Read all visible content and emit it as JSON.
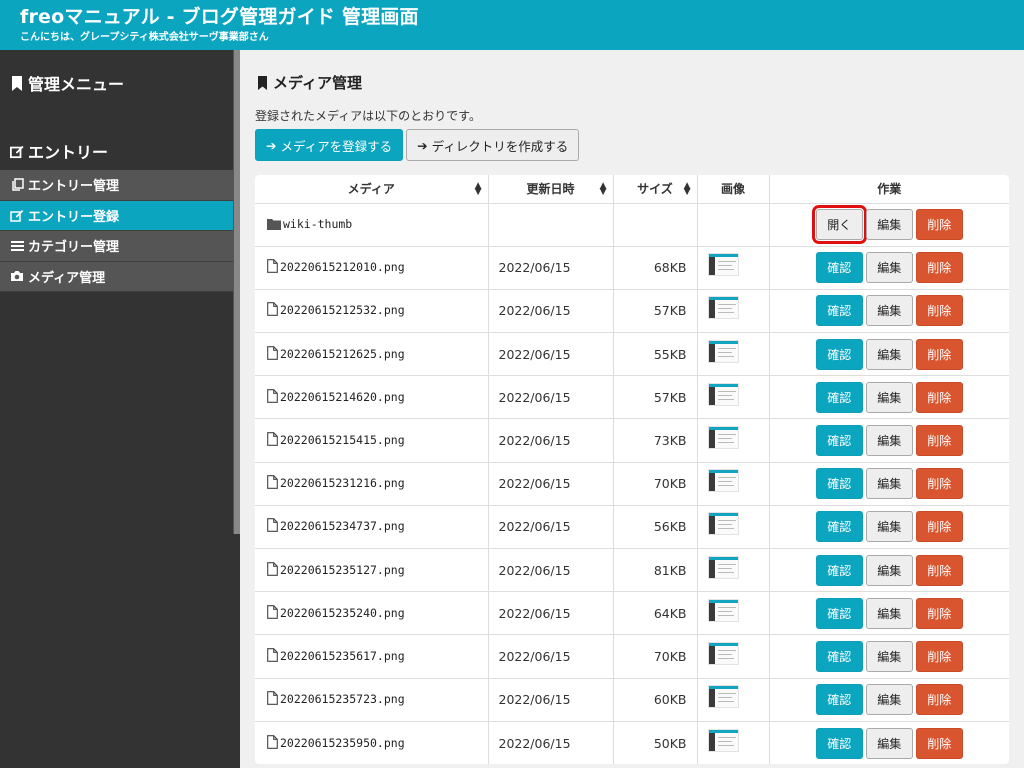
{
  "header": {
    "title": "freoマニュアル - ブログ管理ガイド 管理画面",
    "subtitle": "こんにちは、グレープシティ株式会社サーヴ事業部さん"
  },
  "sidebar": {
    "menu_heading": "管理メニュー",
    "entry_heading": "エントリー",
    "items": [
      {
        "label": "エントリー管理",
        "icon": "copy-icon",
        "active": false
      },
      {
        "label": "エントリー登録",
        "icon": "edit-icon",
        "active": true
      },
      {
        "label": "カテゴリー管理",
        "icon": "list-icon",
        "active": false
      },
      {
        "label": "メディア管理",
        "icon": "camera-icon",
        "active": false
      }
    ]
  },
  "main": {
    "title": "メディア管理",
    "description": "登録されたメディアは以下のとおりです。",
    "register_button": "メディアを登録する",
    "mkdir_button": "ディレクトリを作成する",
    "columns": {
      "media": "メディア",
      "updated": "更新日時",
      "size": "サイズ",
      "image": "画像",
      "actions": "作業"
    },
    "button_labels": {
      "open": "開く",
      "confirm": "確認",
      "edit": "編集",
      "delete": "削除"
    },
    "rows": [
      {
        "name": "wiki-thumb",
        "type": "folder",
        "date": "",
        "size": ""
      },
      {
        "name": "20220615212010.png",
        "type": "file",
        "date": "2022/06/15",
        "size": "68KB"
      },
      {
        "name": "20220615212532.png",
        "type": "file",
        "date": "2022/06/15",
        "size": "57KB"
      },
      {
        "name": "20220615212625.png",
        "type": "file",
        "date": "2022/06/15",
        "size": "55KB"
      },
      {
        "name": "20220615214620.png",
        "type": "file",
        "date": "2022/06/15",
        "size": "57KB"
      },
      {
        "name": "20220615215415.png",
        "type": "file",
        "date": "2022/06/15",
        "size": "73KB"
      },
      {
        "name": "20220615231216.png",
        "type": "file",
        "date": "2022/06/15",
        "size": "70KB"
      },
      {
        "name": "20220615234737.png",
        "type": "file",
        "date": "2022/06/15",
        "size": "56KB"
      },
      {
        "name": "20220615235127.png",
        "type": "file",
        "date": "2022/06/15",
        "size": "81KB"
      },
      {
        "name": "20220615235240.png",
        "type": "file",
        "date": "2022/06/15",
        "size": "64KB"
      },
      {
        "name": "20220615235617.png",
        "type": "file",
        "date": "2022/06/15",
        "size": "70KB"
      },
      {
        "name": "20220615235723.png",
        "type": "file",
        "date": "2022/06/15",
        "size": "60KB"
      },
      {
        "name": "20220615235950.png",
        "type": "file",
        "date": "2022/06/15",
        "size": "50KB"
      }
    ]
  },
  "colors": {
    "accent": "#0ba5c0",
    "danger": "#d9552f",
    "sidebar_bg": "#333333",
    "highlight": "#e01010"
  }
}
